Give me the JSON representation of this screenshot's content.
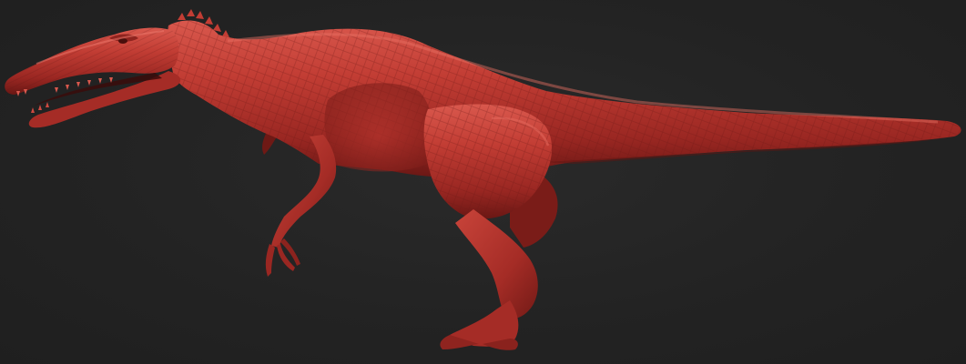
{
  "scene": {
    "subject_icon": "dinosaur-sculpt",
    "background_color": "#222222",
    "material_color": "#b5312b",
    "material_highlight": "#e0675c",
    "material_shadow": "#5e1512"
  }
}
